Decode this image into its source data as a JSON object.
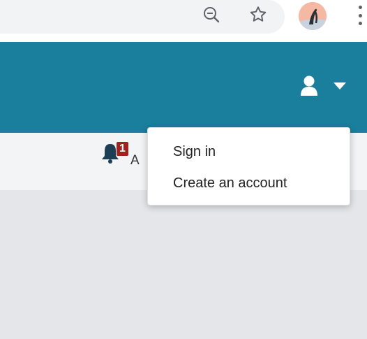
{
  "browser": {
    "toolbar_icons": [
      "zoom-out-icon",
      "bookmark-star-icon",
      "profile-avatar",
      "more-menu-icon"
    ]
  },
  "header": {
    "background_color": "#1a7f9c",
    "user_icon": "user-icon",
    "caret_icon": "caret-down-icon"
  },
  "notification": {
    "badge_count": "1",
    "text_visible": "A",
    "badge_color": "#a3201c"
  },
  "user_dropdown": {
    "items": [
      {
        "label": "Sign in"
      },
      {
        "label": "Create an account"
      }
    ]
  }
}
